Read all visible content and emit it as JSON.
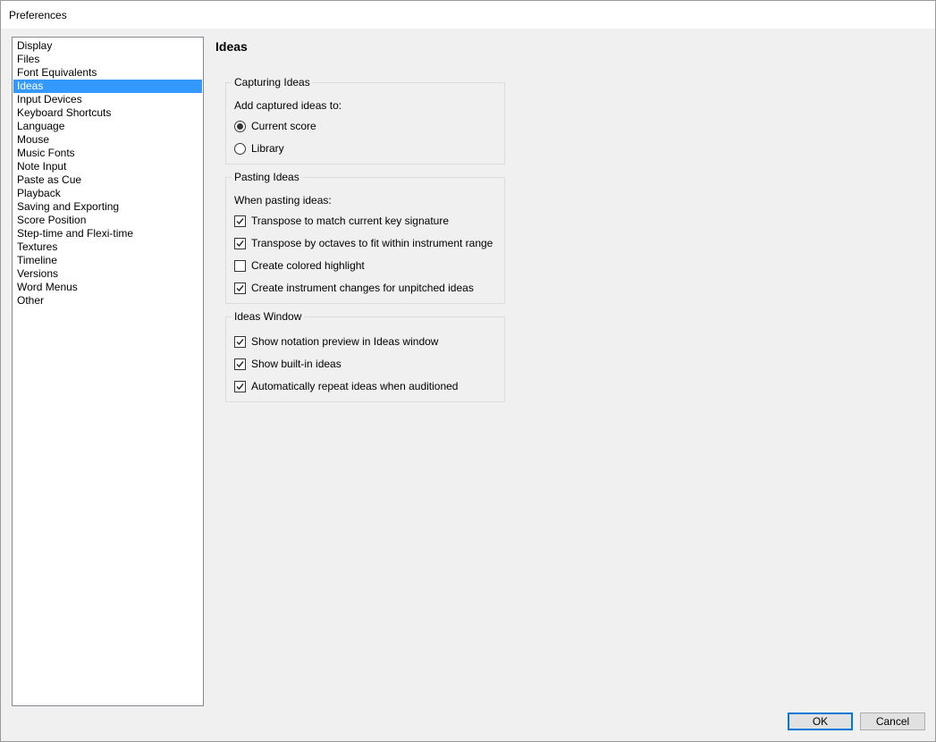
{
  "window": {
    "title": "Preferences"
  },
  "sidebar": {
    "items": [
      {
        "label": "Display",
        "selected": false
      },
      {
        "label": "Files",
        "selected": false
      },
      {
        "label": "Font Equivalents",
        "selected": false
      },
      {
        "label": "Ideas",
        "selected": true
      },
      {
        "label": "Input Devices",
        "selected": false
      },
      {
        "label": "Keyboard Shortcuts",
        "selected": false
      },
      {
        "label": "Language",
        "selected": false
      },
      {
        "label": "Mouse",
        "selected": false
      },
      {
        "label": "Music Fonts",
        "selected": false
      },
      {
        "label": "Note Input",
        "selected": false
      },
      {
        "label": "Paste as Cue",
        "selected": false
      },
      {
        "label": "Playback",
        "selected": false
      },
      {
        "label": "Saving and Exporting",
        "selected": false
      },
      {
        "label": "Score Position",
        "selected": false
      },
      {
        "label": "Step-time and Flexi-time",
        "selected": false
      },
      {
        "label": "Textures",
        "selected": false
      },
      {
        "label": "Timeline",
        "selected": false
      },
      {
        "label": "Versions",
        "selected": false
      },
      {
        "label": "Word Menus",
        "selected": false
      },
      {
        "label": "Other",
        "selected": false
      }
    ]
  },
  "page": {
    "title": "Ideas",
    "capturing": {
      "title": "Capturing Ideas",
      "caption": "Add captured ideas to:",
      "options": [
        {
          "label": "Current score",
          "checked": true
        },
        {
          "label": "Library",
          "checked": false
        }
      ]
    },
    "pasting": {
      "title": "Pasting Ideas",
      "caption": "When pasting ideas:",
      "options": [
        {
          "label": "Transpose to match current key signature",
          "checked": true
        },
        {
          "label": "Transpose by octaves to fit within instrument range",
          "checked": true
        },
        {
          "label": "Create colored highlight",
          "checked": false
        },
        {
          "label": "Create instrument changes for unpitched ideas",
          "checked": true
        }
      ]
    },
    "window_group": {
      "title": "Ideas Window",
      "options": [
        {
          "label": "Show notation preview in Ideas window",
          "checked": true
        },
        {
          "label": "Show built-in ideas",
          "checked": true
        },
        {
          "label": "Automatically repeat ideas when auditioned",
          "checked": true
        }
      ]
    }
  },
  "footer": {
    "ok_label": "OK",
    "cancel_label": "Cancel"
  },
  "colors": {
    "selection": "#3399ff",
    "default_button_border": "#0078d7"
  }
}
